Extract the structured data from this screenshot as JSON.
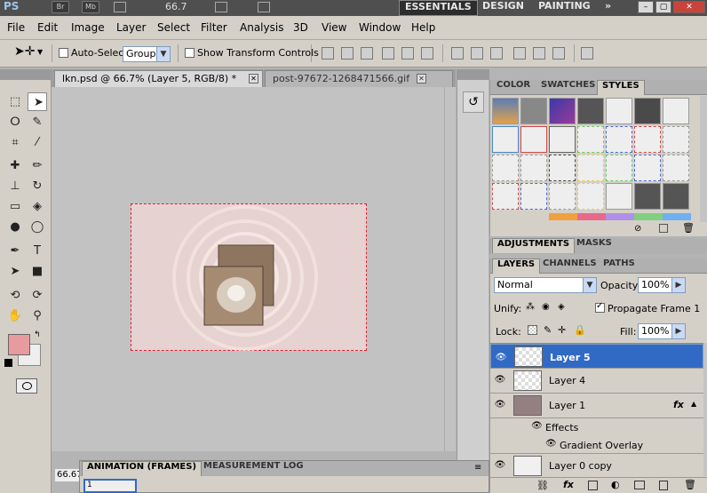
{
  "app_bar": {
    "logo": "PS",
    "chips": [
      "Br",
      "Mb"
    ],
    "zoom": "66.7",
    "workspaces": [
      "ESSENTIALS",
      "DESIGN",
      "PAINTING"
    ],
    "more": "»"
  },
  "menu": [
    "File",
    "Edit",
    "Image",
    "Layer",
    "Select",
    "Filter",
    "Analysis",
    "3D",
    "View",
    "Window",
    "Help"
  ],
  "options": {
    "auto_select_label": "Auto-Select:",
    "auto_select_value": "Group",
    "show_transform_label": "Show Transform Controls"
  },
  "tabs": [
    {
      "label": "lkn.psd @ 66.7% (Layer 5, RGB/8) *"
    },
    {
      "label": "post-97672-1268471566.gif"
    }
  ],
  "status": {
    "zoom": "66.67"
  },
  "styles_panel": {
    "tabs": [
      "COLOR",
      "SWATCHES",
      "STYLES"
    ]
  },
  "adjustments_panel": {
    "tabs": [
      "ADJUSTMENTS",
      "MASKS"
    ]
  },
  "layers_panel": {
    "tabs": [
      "LAYERS",
      "CHANNELS",
      "PATHS"
    ],
    "blend_mode": "Normal",
    "opacity_label": "Opacity:",
    "opacity": "100%",
    "unify_label": "Unify:",
    "propagate_label": "Propagate Frame 1",
    "lock_label": "Lock:",
    "fill_label": "Fill:",
    "fill": "100%",
    "layers": [
      {
        "name": "Layer 5"
      },
      {
        "name": "Layer 4"
      },
      {
        "name": "Layer 1"
      }
    ],
    "effects_label": "Effects",
    "gradient_label": "Gradient Overlay",
    "layer0": "Layer 0 copy",
    "fx": "fx"
  },
  "animation_panel": {
    "tabs": [
      "ANIMATION (FRAMES)",
      "MEASUREMENT LOG"
    ],
    "frame": "1"
  },
  "colors": {
    "foreground": "#e89b9e",
    "background": "#eeeeee",
    "selected_layer": "#316ac5"
  }
}
